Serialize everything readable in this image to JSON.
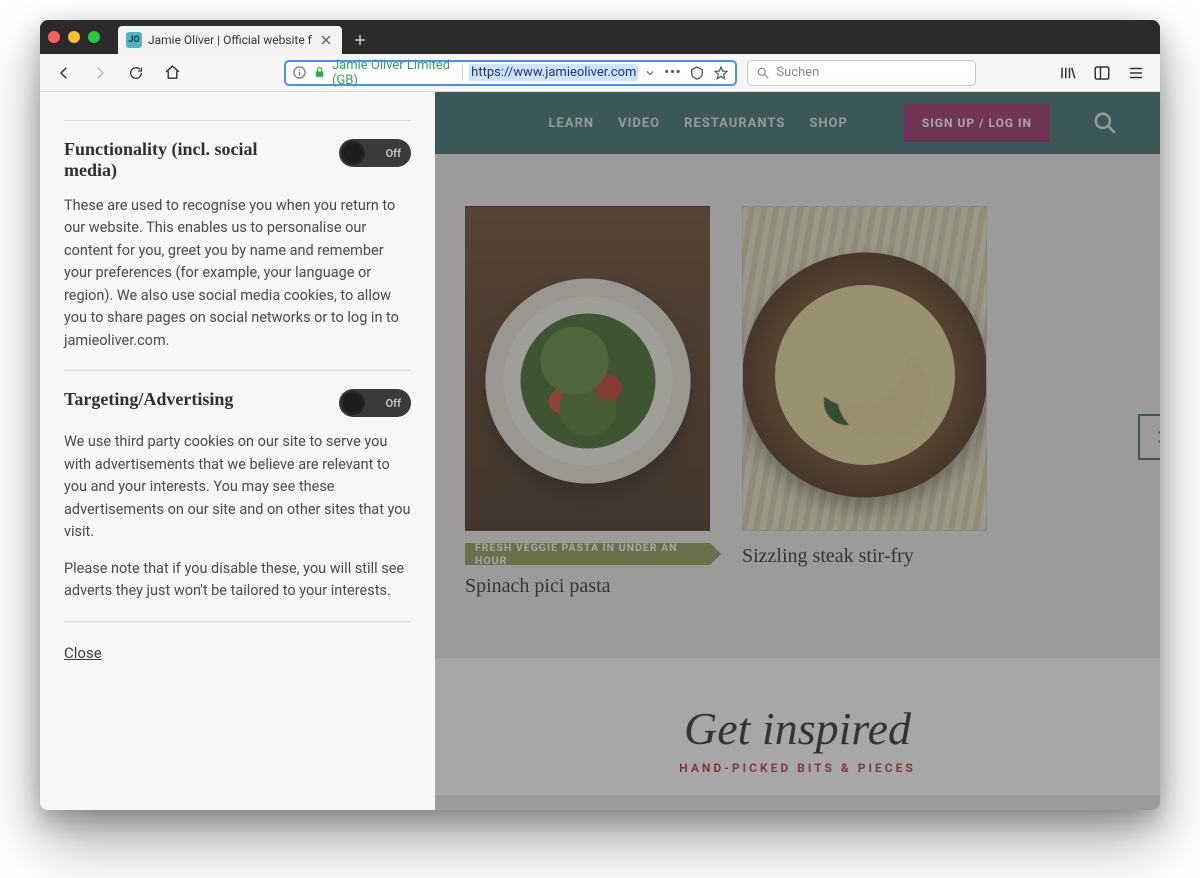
{
  "browser": {
    "tab": {
      "favicon_text": "JO",
      "title": "Jamie Oliver | Official website f"
    },
    "urlbar": {
      "org": "Jamie Oliver Limited (GB)",
      "url": "https://www.jamieoliver.com"
    },
    "search": {
      "placeholder": "Suchen"
    }
  },
  "site": {
    "nav": {
      "learn": "LEARN",
      "video": "VIDEO",
      "restaurants": "RESTAURANTS",
      "shop": "SHOP"
    },
    "signup": "SIGN UP / LOG IN",
    "cards": [
      {
        "ribbon": "FRESH VEGGIE PASTA IN UNDER AN HOUR",
        "title": "Spinach pici pasta"
      },
      {
        "title": "Sizzling steak stir-fry"
      }
    ],
    "inspired": {
      "title": "Get inspired",
      "subtitle": "HAND-PICKED BITS & PIECES"
    }
  },
  "cookies": {
    "sections": [
      {
        "heading": "Functionality (incl. social media)",
        "state": "Off",
        "paragraphs": [
          "These are used to recognise you when you return to our website. This enables us to personalise our content for you, greet you by name and remember your preferences (for example, your language or region). We also use social media cookies, to allow you to share pages on social networks or to log in to jamieoliver.com."
        ]
      },
      {
        "heading": "Targeting/Advertising",
        "state": "Off",
        "paragraphs": [
          "We use third party cookies on our site to serve you with advertisements that we believe are relevant to you and your interests. You may see these advertisements on our site and on other sites that you visit.",
          "Please note that if you disable these, you will still see adverts they just won't be tailored to your interests."
        ]
      }
    ],
    "close": "Close"
  }
}
